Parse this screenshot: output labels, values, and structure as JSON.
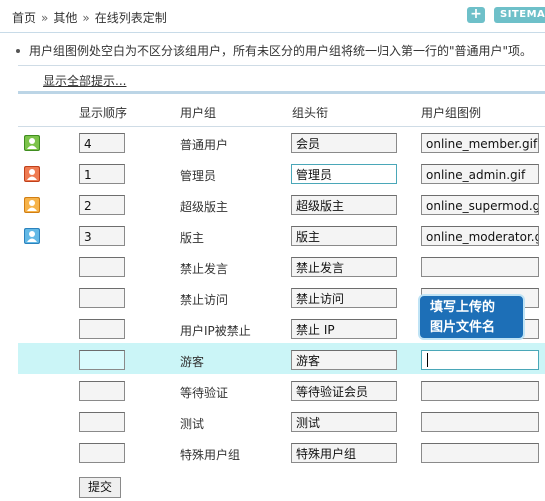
{
  "breadcrumb": {
    "home": "首页",
    "section": "其他",
    "page": "在线列表定制",
    "separator": "»"
  },
  "toolbar": {
    "add_label": "+",
    "sitemap_label": "SITEMAP"
  },
  "tip": {
    "text": "用户组图例处空白为不区分该组用户，所有未区分的用户组将统一归入第一行的\"普通用户\"项。"
  },
  "show_all_label": "显示全部提示...",
  "table": {
    "headers": [
      "显示顺序",
      "用户组",
      "组头衔",
      "用户组图例"
    ],
    "rows": [
      {
        "icon": "green-user-icon",
        "order": "4",
        "group": "普通用户",
        "title": "会员",
        "image": "online_member.gif"
      },
      {
        "icon": "red-user-icon",
        "order": "1",
        "group": "管理员",
        "title": "管理员",
        "image": "online_admin.gif"
      },
      {
        "icon": "orange-user-icon",
        "order": "2",
        "group": "超级版主",
        "title": "超级版主",
        "image": "online_supermod.gif"
      },
      {
        "icon": "blue-user-icon",
        "order": "3",
        "group": "版主",
        "title": "版主",
        "image": "online_moderator.gif"
      },
      {
        "icon": "",
        "order": "",
        "group": "禁止发言",
        "title": "禁止发言",
        "image": ""
      },
      {
        "icon": "",
        "order": "",
        "group": "禁止访问",
        "title": "禁止访问",
        "image": ""
      },
      {
        "icon": "",
        "order": "",
        "group": "用户IP被禁止",
        "title": "禁止 IP",
        "image": ""
      },
      {
        "icon": "",
        "order": "",
        "group": "游客",
        "title": "游客",
        "image": ""
      },
      {
        "icon": "",
        "order": "",
        "group": "等待验证",
        "title": "等待验证会员",
        "image": ""
      },
      {
        "icon": "",
        "order": "",
        "group": "测试",
        "title": "测试",
        "image": ""
      },
      {
        "icon": "",
        "order": "",
        "group": "特殊用户组",
        "title": "特殊用户组",
        "image": ""
      }
    ]
  },
  "callout": {
    "line1": "填写上传的",
    "line2": "图片文件名"
  },
  "submit_label": "提交",
  "colors": {
    "accent": "#6ec0c9",
    "highlight_row": "#cbf5f7",
    "callout": "#1d6fb7"
  }
}
